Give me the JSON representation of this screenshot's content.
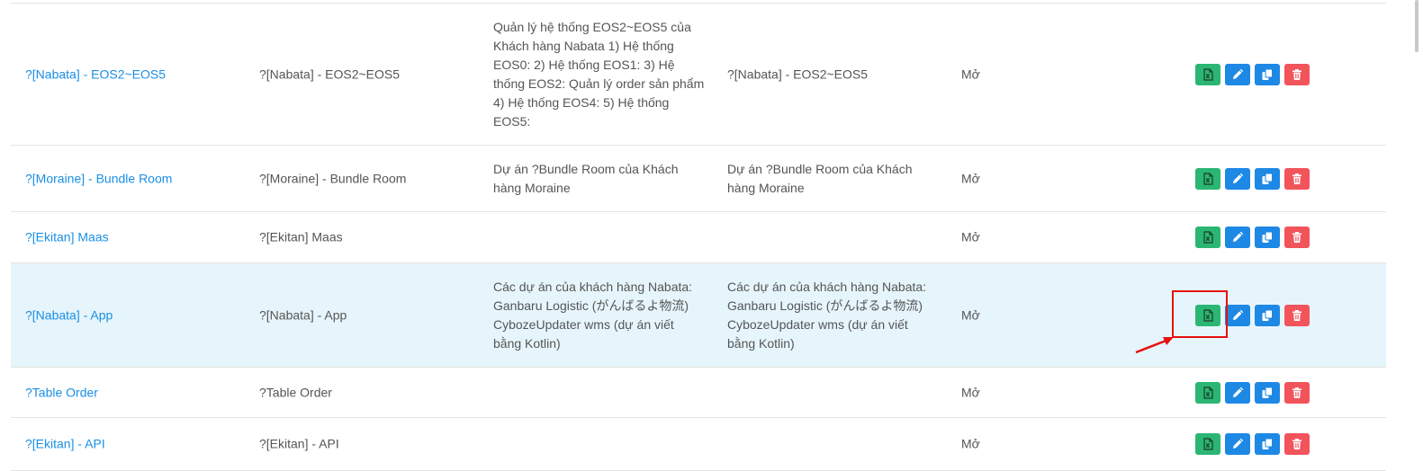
{
  "table": {
    "rows": [
      {
        "name": "?[Nabata] - EOS2~EOS5",
        "code": "?[Nabata] - EOS2~EOS5",
        "description": [
          "Quản lý hệ thống EOS2~EOS5 của",
          "Khách hàng Nabata 1) Hệ thống",
          "EOS0: 2) Hệ thống EOS1: 3) Hệ",
          "thống EOS2: Quản lý order sản phẩm",
          "4) Hệ thống EOS4: 5) Hệ thống",
          "EOS5:"
        ],
        "description2": [
          "?[Nabata] - EOS2~EOS5"
        ],
        "status": "Mở"
      },
      {
        "name": "?[Moraine] - Bundle Room",
        "code": "?[Moraine] - Bundle Room",
        "description": [
          "Dự án ?Bundle Room của Khách",
          "hàng Moraine"
        ],
        "description2": [
          "Dự án ?Bundle Room của Khách",
          "hàng Moraine"
        ],
        "status": "Mở"
      },
      {
        "name": "?[Ekitan] Maas",
        "code": "?[Ekitan] Maas",
        "description": [],
        "description2": [],
        "status": "Mở"
      },
      {
        "name": "?[Nabata] - App",
        "code": "?[Nabata] - App",
        "description": [
          "Các dự án của khách hàng Nabata:",
          "Ganbaru Logistic (がんばるよ物流)",
          "CybozeUpdater wms (dự án viết",
          "bằng Kotlin)"
        ],
        "description2": [
          "Các dự án của khách hàng Nabata:",
          "Ganbaru Logistic (がんばるよ物流)",
          "CybozeUpdater wms (dự án viết",
          "bằng Kotlin)"
        ],
        "status": "Mở"
      },
      {
        "name": "?Table Order",
        "code": "?Table Order",
        "description": [],
        "description2": [],
        "status": "Mở"
      },
      {
        "name": "?[Ekitan] - API",
        "code": "?[Ekitan] - API",
        "description": [],
        "description2": [],
        "status": "Mở"
      }
    ]
  },
  "icons": {
    "excel": "file-excel-icon",
    "edit": "pencil-icon",
    "copy": "copy-icon",
    "delete": "trash-icon"
  },
  "colors": {
    "link": "#1a8fe3",
    "excel_button": "#2bb673",
    "edit_button": "#1e88e5",
    "delete_button": "#f2545b",
    "highlight_row": "#e6f5fc",
    "annotation": "#e81010"
  }
}
